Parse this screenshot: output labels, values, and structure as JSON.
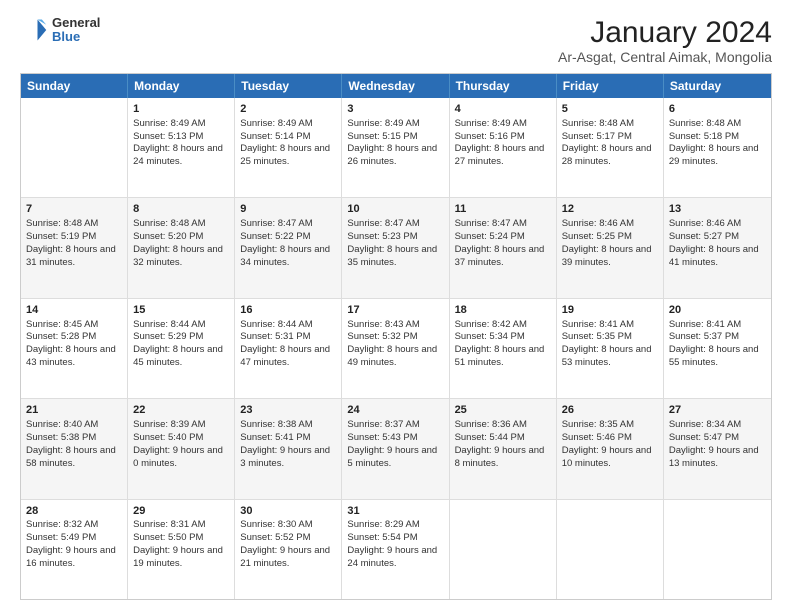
{
  "logo": {
    "general": "General",
    "blue": "Blue"
  },
  "title": "January 2024",
  "subtitle": "Ar-Asgat, Central Aimak, Mongolia",
  "days": [
    "Sunday",
    "Monday",
    "Tuesday",
    "Wednesday",
    "Thursday",
    "Friday",
    "Saturday"
  ],
  "weeks": [
    {
      "alt": false,
      "cells": [
        {
          "num": "",
          "sunrise": "",
          "sunset": "",
          "daylight": ""
        },
        {
          "num": "1",
          "sunrise": "Sunrise: 8:49 AM",
          "sunset": "Sunset: 5:13 PM",
          "daylight": "Daylight: 8 hours and 24 minutes."
        },
        {
          "num": "2",
          "sunrise": "Sunrise: 8:49 AM",
          "sunset": "Sunset: 5:14 PM",
          "daylight": "Daylight: 8 hours and 25 minutes."
        },
        {
          "num": "3",
          "sunrise": "Sunrise: 8:49 AM",
          "sunset": "Sunset: 5:15 PM",
          "daylight": "Daylight: 8 hours and 26 minutes."
        },
        {
          "num": "4",
          "sunrise": "Sunrise: 8:49 AM",
          "sunset": "Sunset: 5:16 PM",
          "daylight": "Daylight: 8 hours and 27 minutes."
        },
        {
          "num": "5",
          "sunrise": "Sunrise: 8:48 AM",
          "sunset": "Sunset: 5:17 PM",
          "daylight": "Daylight: 8 hours and 28 minutes."
        },
        {
          "num": "6",
          "sunrise": "Sunrise: 8:48 AM",
          "sunset": "Sunset: 5:18 PM",
          "daylight": "Daylight: 8 hours and 29 minutes."
        }
      ]
    },
    {
      "alt": true,
      "cells": [
        {
          "num": "7",
          "sunrise": "Sunrise: 8:48 AM",
          "sunset": "Sunset: 5:19 PM",
          "daylight": "Daylight: 8 hours and 31 minutes."
        },
        {
          "num": "8",
          "sunrise": "Sunrise: 8:48 AM",
          "sunset": "Sunset: 5:20 PM",
          "daylight": "Daylight: 8 hours and 32 minutes."
        },
        {
          "num": "9",
          "sunrise": "Sunrise: 8:47 AM",
          "sunset": "Sunset: 5:22 PM",
          "daylight": "Daylight: 8 hours and 34 minutes."
        },
        {
          "num": "10",
          "sunrise": "Sunrise: 8:47 AM",
          "sunset": "Sunset: 5:23 PM",
          "daylight": "Daylight: 8 hours and 35 minutes."
        },
        {
          "num": "11",
          "sunrise": "Sunrise: 8:47 AM",
          "sunset": "Sunset: 5:24 PM",
          "daylight": "Daylight: 8 hours and 37 minutes."
        },
        {
          "num": "12",
          "sunrise": "Sunrise: 8:46 AM",
          "sunset": "Sunset: 5:25 PM",
          "daylight": "Daylight: 8 hours and 39 minutes."
        },
        {
          "num": "13",
          "sunrise": "Sunrise: 8:46 AM",
          "sunset": "Sunset: 5:27 PM",
          "daylight": "Daylight: 8 hours and 41 minutes."
        }
      ]
    },
    {
      "alt": false,
      "cells": [
        {
          "num": "14",
          "sunrise": "Sunrise: 8:45 AM",
          "sunset": "Sunset: 5:28 PM",
          "daylight": "Daylight: 8 hours and 43 minutes."
        },
        {
          "num": "15",
          "sunrise": "Sunrise: 8:44 AM",
          "sunset": "Sunset: 5:29 PM",
          "daylight": "Daylight: 8 hours and 45 minutes."
        },
        {
          "num": "16",
          "sunrise": "Sunrise: 8:44 AM",
          "sunset": "Sunset: 5:31 PM",
          "daylight": "Daylight: 8 hours and 47 minutes."
        },
        {
          "num": "17",
          "sunrise": "Sunrise: 8:43 AM",
          "sunset": "Sunset: 5:32 PM",
          "daylight": "Daylight: 8 hours and 49 minutes."
        },
        {
          "num": "18",
          "sunrise": "Sunrise: 8:42 AM",
          "sunset": "Sunset: 5:34 PM",
          "daylight": "Daylight: 8 hours and 51 minutes."
        },
        {
          "num": "19",
          "sunrise": "Sunrise: 8:41 AM",
          "sunset": "Sunset: 5:35 PM",
          "daylight": "Daylight: 8 hours and 53 minutes."
        },
        {
          "num": "20",
          "sunrise": "Sunrise: 8:41 AM",
          "sunset": "Sunset: 5:37 PM",
          "daylight": "Daylight: 8 hours and 55 minutes."
        }
      ]
    },
    {
      "alt": true,
      "cells": [
        {
          "num": "21",
          "sunrise": "Sunrise: 8:40 AM",
          "sunset": "Sunset: 5:38 PM",
          "daylight": "Daylight: 8 hours and 58 minutes."
        },
        {
          "num": "22",
          "sunrise": "Sunrise: 8:39 AM",
          "sunset": "Sunset: 5:40 PM",
          "daylight": "Daylight: 9 hours and 0 minutes."
        },
        {
          "num": "23",
          "sunrise": "Sunrise: 8:38 AM",
          "sunset": "Sunset: 5:41 PM",
          "daylight": "Daylight: 9 hours and 3 minutes."
        },
        {
          "num": "24",
          "sunrise": "Sunrise: 8:37 AM",
          "sunset": "Sunset: 5:43 PM",
          "daylight": "Daylight: 9 hours and 5 minutes."
        },
        {
          "num": "25",
          "sunrise": "Sunrise: 8:36 AM",
          "sunset": "Sunset: 5:44 PM",
          "daylight": "Daylight: 9 hours and 8 minutes."
        },
        {
          "num": "26",
          "sunrise": "Sunrise: 8:35 AM",
          "sunset": "Sunset: 5:46 PM",
          "daylight": "Daylight: 9 hours and 10 minutes."
        },
        {
          "num": "27",
          "sunrise": "Sunrise: 8:34 AM",
          "sunset": "Sunset: 5:47 PM",
          "daylight": "Daylight: 9 hours and 13 minutes."
        }
      ]
    },
    {
      "alt": false,
      "cells": [
        {
          "num": "28",
          "sunrise": "Sunrise: 8:32 AM",
          "sunset": "Sunset: 5:49 PM",
          "daylight": "Daylight: 9 hours and 16 minutes."
        },
        {
          "num": "29",
          "sunrise": "Sunrise: 8:31 AM",
          "sunset": "Sunset: 5:50 PM",
          "daylight": "Daylight: 9 hours and 19 minutes."
        },
        {
          "num": "30",
          "sunrise": "Sunrise: 8:30 AM",
          "sunset": "Sunset: 5:52 PM",
          "daylight": "Daylight: 9 hours and 21 minutes."
        },
        {
          "num": "31",
          "sunrise": "Sunrise: 8:29 AM",
          "sunset": "Sunset: 5:54 PM",
          "daylight": "Daylight: 9 hours and 24 minutes."
        },
        {
          "num": "",
          "sunrise": "",
          "sunset": "",
          "daylight": ""
        },
        {
          "num": "",
          "sunrise": "",
          "sunset": "",
          "daylight": ""
        },
        {
          "num": "",
          "sunrise": "",
          "sunset": "",
          "daylight": ""
        }
      ]
    }
  ]
}
